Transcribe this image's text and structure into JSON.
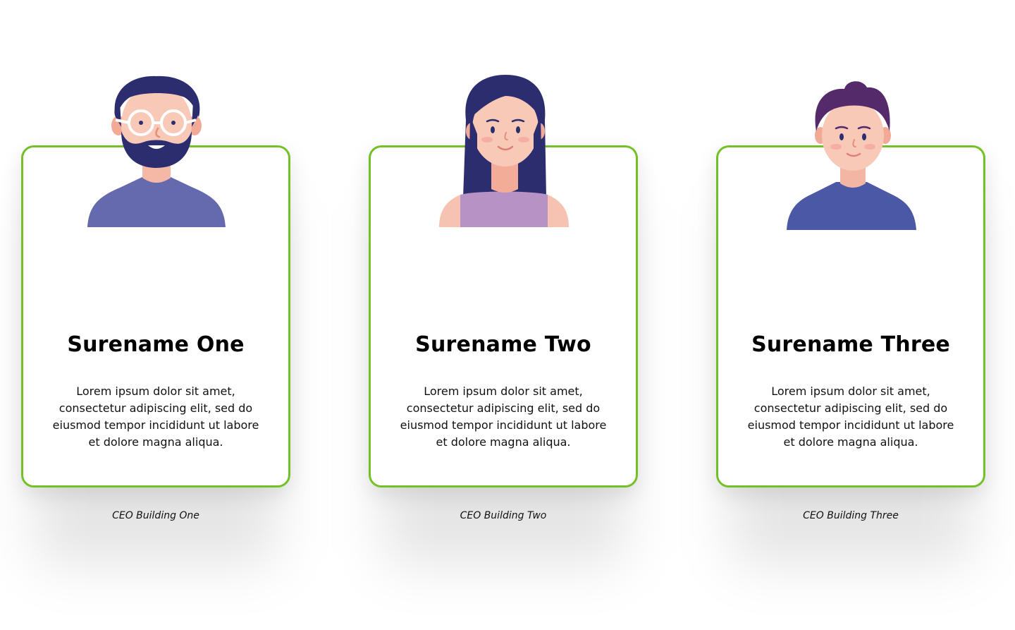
{
  "colors": {
    "card_border": "#74c127",
    "text": "#111111"
  },
  "cards": [
    {
      "name": "Surename One",
      "description": "Lorem ipsum dolor sit amet, consectetur adipiscing elit, sed do eiusmod tempor incididunt ut labore et dolore magna aliqua.",
      "role": "CEO Building One",
      "avatar_icon": "bearded-man-with-glasses-avatar"
    },
    {
      "name": "Surename Two",
      "description": "Lorem ipsum dolor sit amet, consectetur adipiscing elit, sed do eiusmod tempor incididunt ut labore et dolore magna aliqua.",
      "role": "CEO Building Two",
      "avatar_icon": "long-hair-woman-avatar"
    },
    {
      "name": "Surename Three",
      "description": "Lorem ipsum dolor sit amet, consectetur adipiscing elit, sed do eiusmod tempor incididunt ut labore et dolore magna aliqua.",
      "role": "CEO Building Three",
      "avatar_icon": "short-hair-man-avatar"
    }
  ]
}
